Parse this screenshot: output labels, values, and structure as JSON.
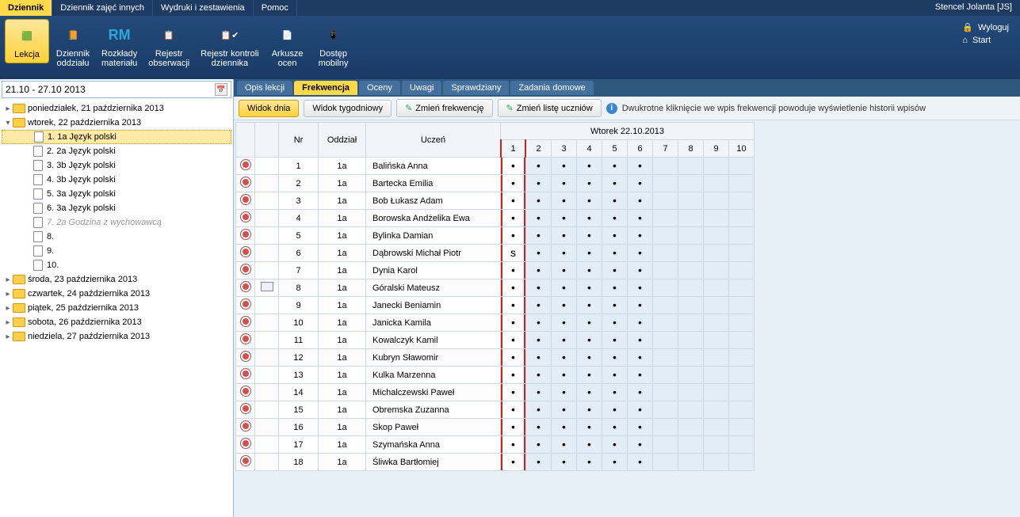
{
  "topbar": {
    "tabs": [
      "Dziennik",
      "Dziennik zajęć innych",
      "Wydruki i zestawienia",
      "Pomoc"
    ],
    "active": 0,
    "user": "Stencel Jolanta [JS]"
  },
  "ribbon": {
    "items": [
      {
        "label": "Lekcja",
        "active": true
      },
      {
        "label": "Dziennik\noddziału"
      },
      {
        "label": "Rozkłady\nmateriału",
        "badge": "RM"
      },
      {
        "label": "Rejestr\nobserwacji"
      },
      {
        "label": "Rejestr kontroli\ndziennika"
      },
      {
        "label": "Arkusze\nocen"
      },
      {
        "label": "Dostęp\nmobilny"
      }
    ],
    "right": [
      {
        "label": "Wyloguj"
      },
      {
        "label": "Start"
      }
    ]
  },
  "sidebar": {
    "date_range": "21.10 - 27.10 2013",
    "days": [
      {
        "label": "poniedziałek, 21 października 2013",
        "expanded": false
      },
      {
        "label": "wtorek, 22 października 2013",
        "expanded": true,
        "lessons": [
          {
            "label": "1. 1a Język polski",
            "selected": true
          },
          {
            "label": "2. 2a Język polski"
          },
          {
            "label": "3. 3b Język polski"
          },
          {
            "label": "4. 3b Język polski"
          },
          {
            "label": "5. 3a Język polski"
          },
          {
            "label": "6. 3a Język polski"
          },
          {
            "label": "7. 2a Godzina z wychowawcą",
            "disabled": true
          },
          {
            "label": "8."
          },
          {
            "label": "9."
          },
          {
            "label": "10."
          }
        ]
      },
      {
        "label": "środa, 23 października 2013",
        "expanded": false
      },
      {
        "label": "czwartek, 24 października 2013",
        "expanded": false
      },
      {
        "label": "piątek, 25 października 2013",
        "expanded": false
      },
      {
        "label": "sobota, 26 października 2013",
        "expanded": false
      },
      {
        "label": "niedziela, 27 października 2013",
        "expanded": false
      }
    ]
  },
  "subtabs": {
    "items": [
      "Opis lekcji",
      "Frekwencja",
      "Oceny",
      "Uwagi",
      "Sprawdziany",
      "Zadania domowe"
    ],
    "active": 1
  },
  "toolbar": {
    "view_day": "Widok dnia",
    "view_week": "Widok tygodniowy",
    "change_freq": "Zmień frekwencję",
    "change_list": "Zmień listę uczniów",
    "info": "Dwukrotne kliknięcie we wpis frekwencji powoduje wyświetlenie historii wpisów"
  },
  "table": {
    "day_header": "Wtorek 22.10.2013",
    "cols": {
      "nr": "Nr",
      "oddzial": "Oddział",
      "uczen": "Uczeń"
    },
    "periods": [
      "1",
      "2",
      "3",
      "4",
      "5",
      "6",
      "7",
      "8",
      "9",
      "10"
    ],
    "highlight_period": 0,
    "rows": [
      {
        "nr": 1,
        "oddzial": "1a",
        "uczen": "Balińska Anna",
        "note": false,
        "marks": [
          "•",
          "•",
          "•",
          "•",
          "•",
          "•",
          "",
          "",
          "",
          ""
        ]
      },
      {
        "nr": 2,
        "oddzial": "1a",
        "uczen": "Bartecka Emilia",
        "note": false,
        "marks": [
          "•",
          "•",
          "•",
          "•",
          "•",
          "•",
          "",
          "",
          "",
          ""
        ]
      },
      {
        "nr": 3,
        "oddzial": "1a",
        "uczen": "Bob Łukasz Adam",
        "note": false,
        "marks": [
          "•",
          "•",
          "•",
          "•",
          "•",
          "•",
          "",
          "",
          "",
          ""
        ]
      },
      {
        "nr": 4,
        "oddzial": "1a",
        "uczen": "Borowska Andżelika Ewa",
        "note": false,
        "marks": [
          "•",
          "•",
          "•",
          "•",
          "•",
          "•",
          "",
          "",
          "",
          ""
        ]
      },
      {
        "nr": 5,
        "oddzial": "1a",
        "uczen": "Bylinka Damian",
        "note": false,
        "marks": [
          "•",
          "•",
          "•",
          "•",
          "•",
          "•",
          "",
          "",
          "",
          ""
        ]
      },
      {
        "nr": 6,
        "oddzial": "1a",
        "uczen": "Dąbrowski Michał Piotr",
        "note": false,
        "marks": [
          "s",
          "•",
          "•",
          "•",
          "•",
          "•",
          "",
          "",
          "",
          ""
        ]
      },
      {
        "nr": 7,
        "oddzial": "1a",
        "uczen": "Dynia Karol",
        "note": false,
        "marks": [
          "•",
          "•",
          "•",
          "•",
          "•",
          "•",
          "",
          "",
          "",
          ""
        ]
      },
      {
        "nr": 8,
        "oddzial": "1a",
        "uczen": "Góralski Mateusz",
        "note": true,
        "marks": [
          "•",
          "•",
          "•",
          "•",
          "•",
          "•",
          "",
          "",
          "",
          ""
        ]
      },
      {
        "nr": 9,
        "oddzial": "1a",
        "uczen": "Janecki Beniamin",
        "note": false,
        "marks": [
          "•",
          "•",
          "•",
          "•",
          "•",
          "•",
          "",
          "",
          "",
          ""
        ]
      },
      {
        "nr": 10,
        "oddzial": "1a",
        "uczen": "Janicka Kamila",
        "note": false,
        "marks": [
          "•",
          "•",
          "•",
          "•",
          "•",
          "•",
          "",
          "",
          "",
          ""
        ]
      },
      {
        "nr": 11,
        "oddzial": "1a",
        "uczen": "Kowalczyk Kamil",
        "note": false,
        "marks": [
          "•",
          "•",
          "•",
          "•",
          "•",
          "•",
          "",
          "",
          "",
          ""
        ]
      },
      {
        "nr": 12,
        "oddzial": "1a",
        "uczen": "Kubryn Sławomir",
        "note": false,
        "marks": [
          "•",
          "•",
          "•",
          "•",
          "•",
          "•",
          "",
          "",
          "",
          ""
        ]
      },
      {
        "nr": 13,
        "oddzial": "1a",
        "uczen": "Kulka Marzenna",
        "note": false,
        "marks": [
          "•",
          "•",
          "•",
          "•",
          "•",
          "•",
          "",
          "",
          "",
          ""
        ]
      },
      {
        "nr": 14,
        "oddzial": "1a",
        "uczen": "Michalczewski Paweł",
        "note": false,
        "marks": [
          "•",
          "•",
          "•",
          "•",
          "•",
          "•",
          "",
          "",
          "",
          ""
        ]
      },
      {
        "nr": 15,
        "oddzial": "1a",
        "uczen": "Obremska Zuzanna",
        "note": false,
        "marks": [
          "•",
          "•",
          "•",
          "•",
          "•",
          "•",
          "",
          "",
          "",
          ""
        ]
      },
      {
        "nr": 16,
        "oddzial": "1a",
        "uczen": "Skop Paweł",
        "note": false,
        "marks": [
          "•",
          "•",
          "•",
          "•",
          "•",
          "•",
          "",
          "",
          "",
          ""
        ]
      },
      {
        "nr": 17,
        "oddzial": "1a",
        "uczen": "Szymańska Anna",
        "note": false,
        "marks": [
          "•",
          "•",
          "•",
          "•",
          "•",
          "•",
          "",
          "",
          "",
          ""
        ]
      },
      {
        "nr": 18,
        "oddzial": "1a",
        "uczen": "Śliwka Bartłomiej",
        "note": false,
        "marks": [
          "•",
          "•",
          "•",
          "•",
          "•",
          "•",
          "",
          "",
          "",
          ""
        ]
      }
    ]
  }
}
